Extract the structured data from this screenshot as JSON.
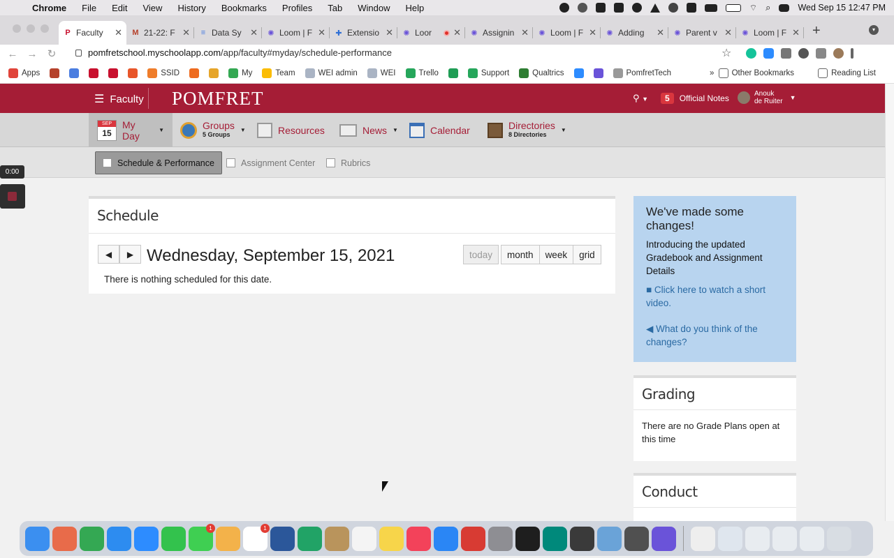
{
  "macos": {
    "app": "Chrome",
    "menus": [
      "File",
      "Edit",
      "View",
      "History",
      "Bookmarks",
      "Profiles",
      "Tab",
      "Window",
      "Help"
    ],
    "clock": "Wed Sep 15  12:47 PM"
  },
  "tabs": [
    {
      "title": "Faculty",
      "active": true,
      "fav": "P",
      "color": "#c8102e"
    },
    {
      "title": "21-22: F",
      "fav": "M",
      "color": "#b5412b"
    },
    {
      "title": "Data Sy",
      "fav": "≡",
      "color": "#4a7de0"
    },
    {
      "title": "Loom | F",
      "fav": "✺",
      "color": "#6a53d9"
    },
    {
      "title": "Extensio",
      "fav": "✚",
      "color": "#2f6fd6"
    },
    {
      "title": "Loor",
      "fav": "✺",
      "color": "#6a53d9",
      "recording": true
    },
    {
      "title": "Assignin",
      "fav": "✺",
      "color": "#6a53d9"
    },
    {
      "title": "Loom | F",
      "fav": "✺",
      "color": "#6a53d9"
    },
    {
      "title": "Adding",
      "fav": "✺",
      "color": "#6a53d9"
    },
    {
      "title": "Parent v",
      "fav": "✺",
      "color": "#6a53d9"
    },
    {
      "title": "Loom | F",
      "fav": "✺",
      "color": "#6a53d9"
    }
  ],
  "address": {
    "domain": "pomfretschool.myschoolapp.com",
    "path": "/app/faculty#myday/schedule-performance"
  },
  "bookmarks": [
    {
      "label": "Apps",
      "color": "#e0443a"
    },
    {
      "label": "",
      "color": "#b5412b"
    },
    {
      "label": "",
      "color": "#4a7de0"
    },
    {
      "label": "",
      "color": "#c8102e"
    },
    {
      "label": "",
      "color": "#c8102e"
    },
    {
      "label": "",
      "color": "#e8562a"
    },
    {
      "label": "SSID",
      "color": "#ef7d2b"
    },
    {
      "label": "",
      "color": "#ee6b1f"
    },
    {
      "label": "",
      "color": "#e6a52a"
    },
    {
      "label": "My",
      "color": "#34a853"
    },
    {
      "label": "Team",
      "color": "#fbbc04"
    },
    {
      "label": "WEI admin",
      "color": "#aab4c4"
    },
    {
      "label": "WEI",
      "color": "#aab4c4"
    },
    {
      "label": "Trello",
      "color": "#26a65b"
    },
    {
      "label": "",
      "color": "#1f9d55"
    },
    {
      "label": "Support",
      "color": "#26a65b"
    },
    {
      "label": "Qualtrics",
      "color": "#2e7d32"
    },
    {
      "label": "",
      "color": "#2d8cff"
    },
    {
      "label": "",
      "color": "#6a53d9"
    },
    {
      "label": "PomfretTech",
      "color": "#999999"
    }
  ],
  "bookmarks_right": [
    "Other Bookmarks",
    "Reading List"
  ],
  "header": {
    "menu_label": "Faculty",
    "logo": "POMFRET",
    "notes_count": "5",
    "notes_label": "Official Notes",
    "user_first": "Anouk",
    "user_last": "de Ruiter"
  },
  "mainnav": {
    "myday": {
      "month": "SEP",
      "day": "15",
      "label": "My Day"
    },
    "groups": {
      "label": "Groups",
      "sub": "5 Groups"
    },
    "resources": "Resources",
    "news": "News",
    "calendar": "Calendar",
    "directories": {
      "label": "Directories",
      "sub": "8 Directories"
    }
  },
  "subnav": [
    "Schedule & Performance",
    "Assignment Center",
    "Rubrics"
  ],
  "recorder": {
    "time": "0:00"
  },
  "schedule": {
    "title": "Schedule",
    "date": "Wednesday, September 15, 2021",
    "views": [
      "today",
      "month",
      "week",
      "grid"
    ],
    "empty": "There is nothing scheduled for this date."
  },
  "changes": {
    "title": "We've made some changes!",
    "body": "Introducing the updated Gradebook and Assignment Details",
    "link1": "Click here to watch a short video.",
    "link2": "What do you think of the changes?"
  },
  "grading": {
    "title": "Grading",
    "body": "There are no Grade Plans open at this time"
  },
  "conduct": {
    "title": "Conduct"
  },
  "accent": "#a51d36",
  "dock": {
    "apps": [
      {
        "name": "finder",
        "color": "#3b8ff0"
      },
      {
        "name": "launchpad",
        "color": "#e86b4a"
      },
      {
        "name": "chrome",
        "color": "#34a853"
      },
      {
        "name": "safari",
        "color": "#2d8cf0"
      },
      {
        "name": "zoom",
        "color": "#2d8cff"
      },
      {
        "name": "facetime",
        "color": "#33c24d"
      },
      {
        "name": "messages",
        "color": "#3fcf52",
        "badge": "1"
      },
      {
        "name": "photos",
        "color": "#f3b24a"
      },
      {
        "name": "calendar",
        "color": "#ffffff",
        "badge": "1"
      },
      {
        "name": "word",
        "color": "#2b579a"
      },
      {
        "name": "excel",
        "color": "#21a366"
      },
      {
        "name": "contacts",
        "color": "#b9945c"
      },
      {
        "name": "reminders",
        "color": "#f4f4f4"
      },
      {
        "name": "notes",
        "color": "#f7d54a"
      },
      {
        "name": "news",
        "color": "#f3425a"
      },
      {
        "name": "app-store",
        "color": "#2a86f5"
      },
      {
        "name": "remote-desktop",
        "color": "#d83b33"
      },
      {
        "name": "settings",
        "color": "#8e8e93"
      },
      {
        "name": "terminal",
        "color": "#1e1e1e"
      },
      {
        "name": "meet",
        "color": "#00897b"
      },
      {
        "name": "quicktime",
        "color": "#3a3a3a"
      },
      {
        "name": "preview",
        "color": "#6aa3d8"
      },
      {
        "name": "calculator",
        "color": "#505050"
      },
      {
        "name": "loom",
        "color": "#6a53d9"
      }
    ],
    "right": [
      {
        "name": "document",
        "color": "#eeeeee"
      },
      {
        "name": "window-1",
        "color": "#dfe6ee"
      },
      {
        "name": "window-2",
        "color": "#e8ecf0"
      },
      {
        "name": "window-3",
        "color": "#e8ecf0"
      },
      {
        "name": "window-4",
        "color": "#e8ecf0"
      },
      {
        "name": "trash",
        "color": "#d8dde3"
      }
    ]
  }
}
